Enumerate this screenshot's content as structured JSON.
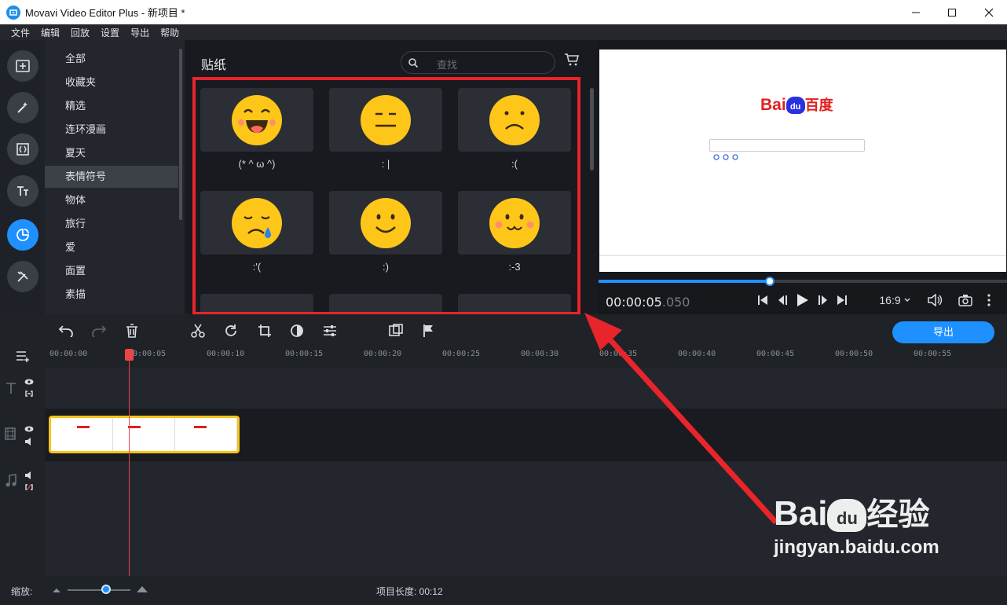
{
  "window": {
    "title": "Movavi Video Editor Plus - 新项目 *"
  },
  "menu": [
    "文件",
    "编辑",
    "回放",
    "设置",
    "导出",
    "帮助"
  ],
  "categories": [
    "全部",
    "收藏夹",
    "精选",
    "连环漫画",
    "夏天",
    "表情符号",
    "物体",
    "旅行",
    "爱",
    "面置",
    "素描"
  ],
  "selected_category": "表情符号",
  "panel": {
    "title": "贴纸",
    "search_placeholder": "查找"
  },
  "stickers": [
    {
      "label": "(* ^ ω ^)",
      "mood": "laugh"
    },
    {
      "label": ": |",
      "mood": "neutral"
    },
    {
      "label": ":(",
      "mood": "sad"
    },
    {
      "label": ":'(",
      "mood": "cry"
    },
    {
      "label": ":)",
      "mood": "smile"
    },
    {
      "label": ":-3",
      "mood": "blush"
    }
  ],
  "player": {
    "time_main": "00:00:05",
    "time_ms": ".050",
    "aspect": "16:9",
    "progress": 0.42
  },
  "preview_page": {
    "logo_bai": "Bai",
    "logo_du": "du",
    "logo_cn": "百度"
  },
  "toolbar": {
    "export_label": "导出"
  },
  "ruler": [
    "00:00:00",
    "00:00:05",
    "00:00:10",
    "00:00:15",
    "00:00:20",
    "00:00:25",
    "00:00:30",
    "00:00:35",
    "00:00:40",
    "00:00:45",
    "00:00:50",
    "00:00:55"
  ],
  "status": {
    "zoom_label": "缩放:",
    "project_length": "项目长度:  00:12"
  },
  "watermark": {
    "brand": "Bai",
    "brand_du": "du",
    "brand_cn": "经验",
    "url": "jingyan.baidu.com"
  },
  "colors": {
    "accent": "#1e90ff",
    "highlight": "#e8252b",
    "clip_border": "#f5c518",
    "emoji": "#ffc61a"
  }
}
